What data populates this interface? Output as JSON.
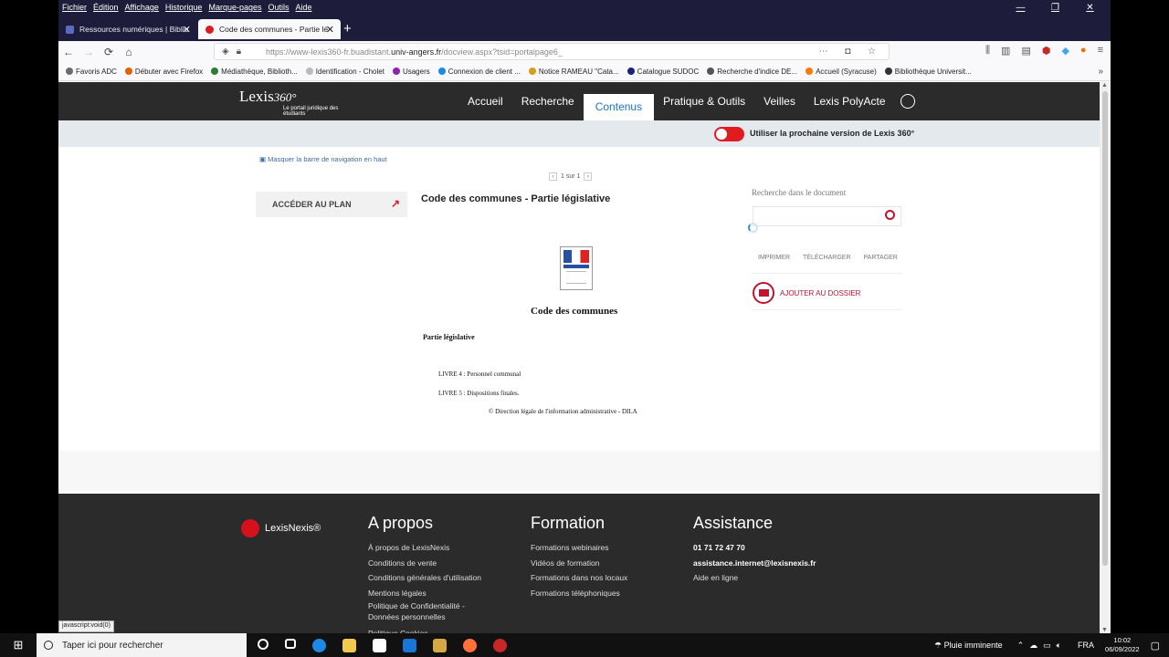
{
  "menubar": [
    "Fichier",
    "Édition",
    "Affichage",
    "Historique",
    "Marque-pages",
    "Outils",
    "Aide"
  ],
  "window_controls": {
    "minimize": "—",
    "maximize": "❐",
    "close": "✕"
  },
  "tabs": [
    {
      "label": "Ressources numériques | Biblio",
      "icon_color": "#5c6bc0",
      "active": false
    },
    {
      "label": "Code des communes - Partie lé",
      "icon_color": "#e11b22",
      "active": true
    }
  ],
  "tab_close": "✕",
  "new_tab": "+",
  "nav": {
    "back": "←",
    "forward": "→",
    "reload": "⟳",
    "home": "⌂"
  },
  "url": {
    "prefix": "https://www-lexis360-fr.buadistant.",
    "domain": "univ-angers.fr",
    "rest": "/docview.aspx?tsid=portalpage6_"
  },
  "bookmarks": [
    {
      "label": "Favoris ADC",
      "color": "#6b6b6b"
    },
    {
      "label": "Débuter avec Firefox",
      "color": "#e66000"
    },
    {
      "label": "Médiathèque, Biblioth...",
      "color": "#2e7d32"
    },
    {
      "label": "Identification - Cholet",
      "color": "#bbbbbb"
    },
    {
      "label": "Usagers",
      "color": "#8e24aa"
    },
    {
      "label": "Connexion de client ...",
      "color": "#1e88e5"
    },
    {
      "label": "Notice RAMEAU \"Cata...",
      "color": "#d4a017"
    },
    {
      "label": "Catalogue SUDOC",
      "color": "#1a237e"
    },
    {
      "label": "Recherche d'indice DE...",
      "color": "#555555"
    },
    {
      "label": "Accueil (Syracuse)",
      "color": "#f57c00"
    },
    {
      "label": "Bibliothèque Universit...",
      "color": "#333333"
    }
  ],
  "bookmarks_more": "»",
  "site": {
    "logo_main": "Lexis",
    "logo_num": "360°",
    "logo_sub": "Le portail juridique des étudiants",
    "nav": [
      {
        "label": "Accueil",
        "active": false
      },
      {
        "label": "Recherche",
        "active": false
      },
      {
        "label": "Contenus",
        "active": true
      },
      {
        "label": "Pratique & Outils",
        "active": false
      },
      {
        "label": "Veilles",
        "active": false
      },
      {
        "label": "Lexis PolyActe",
        "active": false
      }
    ],
    "toggle_label": "Utiliser la prochaine version de Lexis 360°"
  },
  "doc_page": {
    "hide_bar": "Masquer la barre de navigation en haut",
    "pager": "1 sur 1",
    "plan_button": "ACCÉDER AU PLAN",
    "title": "Code des communes - Partie législative",
    "body_title": "Code des communes",
    "part": "Partie législative",
    "livre4": "LIVRE 4 : Personnel communal",
    "livre5": "LIVRE 5 : Dispositions finales.",
    "copyright": "© Direction légale de l'information administrative - DILA",
    "search_label": "Recherche dans le document",
    "actions": [
      "IMPRIMER",
      "TÉLÉCHARGER",
      "PARTAGER"
    ],
    "add_folder": "AJOUTER AU DOSSIER"
  },
  "footer": {
    "brand": "LexisNexis®",
    "cols": [
      {
        "title": "A propos",
        "items": [
          "À propos de LexisNexis",
          "Conditions de vente",
          "Conditions générales d'utilisation",
          "Mentions légales",
          "Politique de Confidentialité - Données personnelles",
          "Politique Cookies"
        ]
      },
      {
        "title": "Formation",
        "items": [
          "Formations webinaires",
          "Vidéos de formation",
          "Formations dans nos locaux",
          "Formations téléphoniques"
        ]
      },
      {
        "title": "Assistance",
        "items": [
          "01 71 72 47 70",
          "assistance.internet@lexisnexis.fr",
          "Aide en ligne"
        ]
      }
    ]
  },
  "status_hint": "javascript:void(0)",
  "taskbar": {
    "search_placeholder": "Taper ici pour rechercher",
    "weather": "Pluie imminente",
    "lang": "FRA",
    "time": "10:02",
    "date": "06/09/2022"
  }
}
